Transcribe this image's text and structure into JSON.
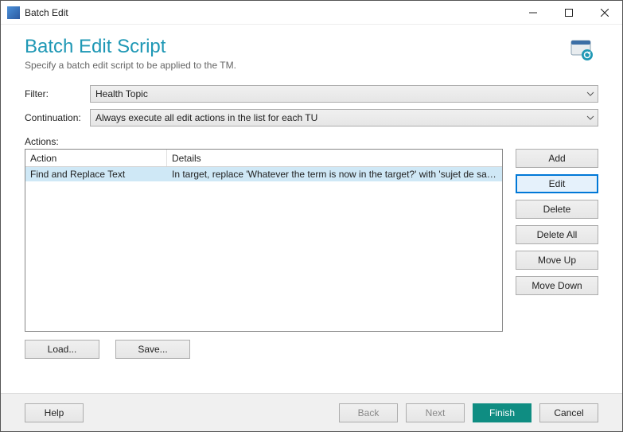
{
  "titlebar": {
    "title": "Batch Edit"
  },
  "header": {
    "title": "Batch Edit Script",
    "subtitle": "Specify a batch edit script to be applied to the TM."
  },
  "form": {
    "filter_label": "Filter:",
    "filter_value": "Health Topic",
    "continuation_label": "Continuation:",
    "continuation_value": "Always execute all edit actions in the list for each TU",
    "actions_label": "Actions:"
  },
  "table": {
    "columns": {
      "action": "Action",
      "details": "Details"
    },
    "rows": [
      {
        "action": "Find and Replace Text",
        "details": "In target, replace 'Whatever the term is now in the target?' with 'sujet de santé'"
      }
    ]
  },
  "side_buttons": {
    "add": "Add",
    "edit": "Edit",
    "delete": "Delete",
    "delete_all": "Delete All",
    "move_up": "Move Up",
    "move_down": "Move Down"
  },
  "bottom_buttons": {
    "load": "Load...",
    "save": "Save..."
  },
  "footer": {
    "help": "Help",
    "back": "Back",
    "next": "Next",
    "finish": "Finish",
    "cancel": "Cancel"
  }
}
